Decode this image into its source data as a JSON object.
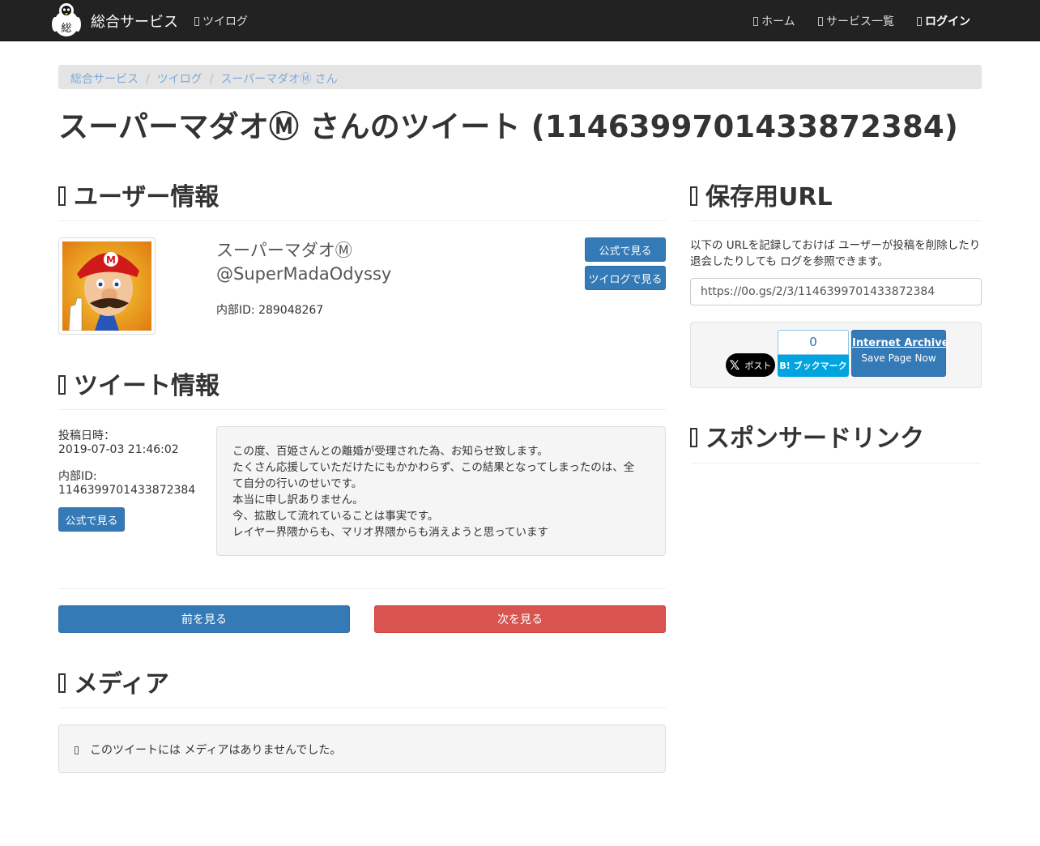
{
  "navbar": {
    "brand": "総合サービス",
    "brand_logo_char": "総",
    "link_tweet_log": "ツイログ",
    "link_home": "ホーム",
    "link_services": "サービス一覧",
    "link_login": "ログイン"
  },
  "breadcrumb": [
    "総合サービス",
    "ツイログ",
    "スーパーマダオⓂ さん"
  ],
  "page_title": "スーパーマダオⓂ さんのツイート (1146399701433872384)",
  "user_section": {
    "heading": "ユーザー情報",
    "display_name": "スーパーマダオⓂ",
    "handle": "@SuperMadaOdyssy",
    "internal_id": "内部ID: 289048267",
    "btn_official": "公式で見る",
    "btn_tweetlog": "ツイログで見る"
  },
  "tweet_section": {
    "heading": "ツイート情報",
    "posted_label": "投稿日時：",
    "posted_value": "2019-07-03 21:46:02",
    "id_label": "内部ID:",
    "id_value": "1146399701433872384",
    "btn_official": "公式で見る",
    "text_lines": [
      "この度、百姫さんとの離婚が受理された為、お知らせ致します。",
      "たくさん応援していただけたにもかかわらず、この結果となってしまったのは、全",
      "て自分の行いのせいです。",
      "本当に申し訳ありません。",
      "今、拡散して流れていることは事実です。",
      "レイヤー界隈からも、マリオ界隈からも消えようと思っています"
    ]
  },
  "pager": {
    "prev": "前を見る",
    "next": "次を見る"
  },
  "media_section": {
    "heading": "メディア",
    "empty_message": "このツイートには メディアはありませんでした。"
  },
  "save_url_section": {
    "heading": "保存用URL",
    "description": "以下の URLを記録しておけば ユーザーが投稿を削除したり 退会したりしても ログを参照できます。",
    "url": "https://0o.gs/2/3/1146399701433872384",
    "tweet_button_label": "ポスト",
    "hatena_count": "0",
    "hatena_label": "B! ブックマーク",
    "ia_title": "Internet Archive",
    "ia_sub": "Save Page Now"
  },
  "sponsored_section": {
    "heading": "スポンサードリンク"
  },
  "colors": {
    "navbar_bg": "#222222",
    "primary": "#337ab7",
    "danger": "#d9534f",
    "hatena": "#00a4de",
    "breadcrumb_link": "#7ca9d8"
  }
}
